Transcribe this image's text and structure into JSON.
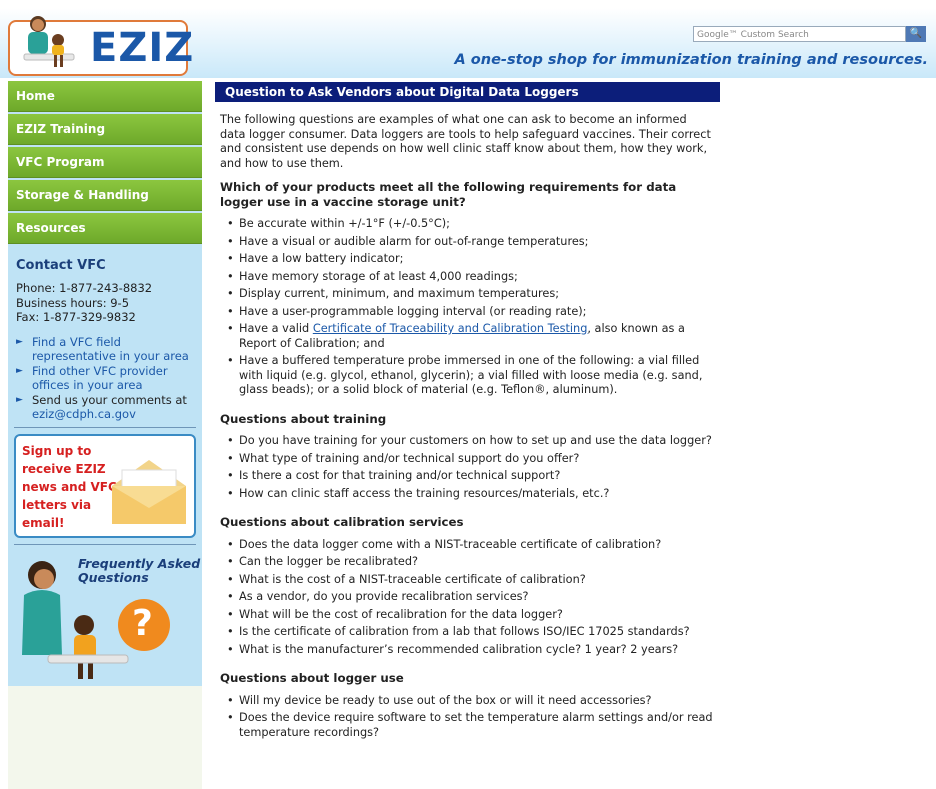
{
  "header": {
    "logo_text": "EZIZ",
    "search_placeholder": "Google™ Custom Search",
    "search_button_icon": "search-icon",
    "search_glyph": "🔍",
    "tagline": "A one-stop shop for immunization training and resources."
  },
  "sidebar": {
    "nav": [
      {
        "label": "Home"
      },
      {
        "label": "EZIZ Training"
      },
      {
        "label": "VFC Program"
      },
      {
        "label": "Storage & Handling"
      },
      {
        "label": "Resources"
      }
    ],
    "contact": {
      "title": "Contact VFC",
      "phone": "Phone: 1-877-243-8832",
      "hours": "Business hours: 9-5",
      "fax": "Fax: 1-877-329-9832"
    },
    "links": [
      {
        "text": "Find a VFC field representative in your area"
      },
      {
        "text": "Find other VFC provider offices in your area"
      },
      {
        "text": "Send us your comments at",
        "email": "eziz@cdph.ca.gov"
      }
    ],
    "signup": "Sign up to receive EZIZ news and VFC letters via email!",
    "faq": "Frequently Asked Questions",
    "faq_mark": "?"
  },
  "main": {
    "title": "Question to Ask Vendors about Digital Data Loggers",
    "intro": "The following questions are examples of what one can ask to become an informed data logger consumer. Data loggers are tools to help safeguard vaccines. Their correct and consistent use depends on how well clinic staff know about them, how they work, and how to use them.",
    "section1": {
      "heading": "Which of your products meet all the following requirements for data logger use in a vaccine storage unit?",
      "items": [
        "Be accurate within +/-1°F (+/-0.5°C);",
        "Have a visual or audible alarm for out-of-range temperatures;",
        "Have a low battery indicator;",
        "Have memory storage of at least 4,000 readings;",
        "Display current, minimum, and maximum temperatures;",
        "Have a user-programmable logging interval (or reading rate);"
      ],
      "cert_prefix": "Have a valid ",
      "cert_link": "Certificate of Traceability and Calibration Testing",
      "cert_suffix": ", also known as a Report of Calibration; and",
      "last_item": "Have a buffered temperature probe immersed in one of the following: a vial filled with liquid (e.g. glycol, ethanol, glycerin); a vial filled with loose media (e.g. sand, glass beads); or a solid block of material (e.g. Teflon®, aluminum)."
    },
    "section2": {
      "heading": "Questions about training",
      "items": [
        "Do you have training for your customers on how to set up and use the data logger?",
        "What type of training and/or technical support do you offer?",
        "Is there a cost for that training and/or technical support?",
        "How can clinic staff access the training resources/materials, etc.?"
      ]
    },
    "section3": {
      "heading": "Questions about calibration services",
      "items": [
        "Does the data logger come with a NIST-traceable certificate of calibration?",
        "Can the logger be recalibrated?",
        "What is the cost of a NIST-traceable certificate of calibration?",
        "As a vendor, do you provide recalibration services?",
        "What will be the cost of recalibration for the data logger?",
        "Is the certificate of calibration from a lab that follows ISO/IEC 17025 standards?",
        "What is the manufacturer’s recommended calibration cycle? 1 year? 2 years?"
      ]
    },
    "section4": {
      "heading": "Questions about logger use",
      "items": [
        "Will my device be ready to use out of the box or will it need accessories?",
        "Does the device require software to set the temperature alarm settings and/or read temperature recordings?"
      ]
    }
  }
}
